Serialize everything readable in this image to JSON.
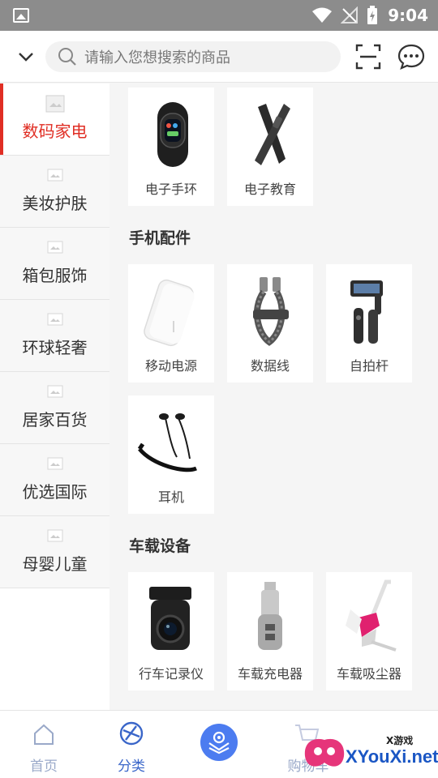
{
  "status_bar": {
    "time": "9:04"
  },
  "header": {
    "search_placeholder": "请输入您想搜索的商品"
  },
  "sidebar": {
    "items": [
      {
        "label": "数码家电",
        "active": true
      },
      {
        "label": "美妆护肤"
      },
      {
        "label": "箱包服饰"
      },
      {
        "label": "环球轻奢"
      },
      {
        "label": "居家百货"
      },
      {
        "label": "优选国际"
      },
      {
        "label": "母婴儿童"
      }
    ]
  },
  "content": {
    "top_items": [
      "电子手环",
      "电子教育"
    ],
    "sections": [
      {
        "title": "手机配件",
        "items": [
          "移动电源",
          "数据线",
          "自拍杆",
          "耳机"
        ]
      },
      {
        "title": "车载设备",
        "items": [
          "行车记录仪",
          "车载充电器",
          "车载吸尘器"
        ]
      }
    ]
  },
  "bottom_nav": {
    "items": [
      {
        "label": "首页"
      },
      {
        "label": "分类",
        "active": true
      },
      {
        "label": "购物车"
      }
    ]
  },
  "watermark": {
    "line1": "X游戏",
    "line2": "XYouXi.net"
  },
  "colors": {
    "accent": "#e02e24",
    "nav_active": "#3a66c9",
    "center_button": "#4c7cf0"
  }
}
